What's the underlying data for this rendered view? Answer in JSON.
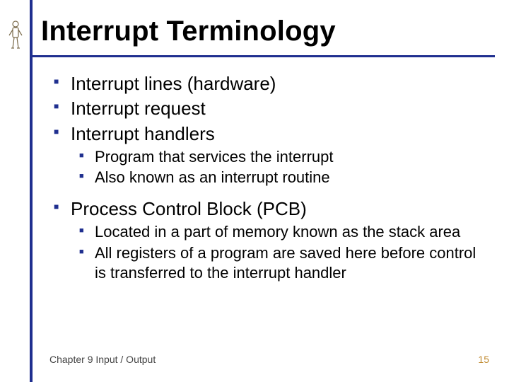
{
  "title": "Interrupt Terminology",
  "bullets": {
    "b1": "Interrupt lines (hardware)",
    "b2": "Interrupt request",
    "b3": "Interrupt handlers",
    "b3_sub": {
      "s1": "Program that services the interrupt",
      "s2": "Also known as an interrupt routine"
    },
    "b4": "Process Control Block (PCB)",
    "b4_sub": {
      "s1": "Located in a part of memory known as the stack area",
      "s2": "All registers of a program are saved here before control is transferred to the interrupt handler"
    }
  },
  "footer": {
    "left": "Chapter 9 Input / Output",
    "page": "15"
  },
  "colors": {
    "accent": "#1f2f8f",
    "page_number": "#c08a30"
  }
}
